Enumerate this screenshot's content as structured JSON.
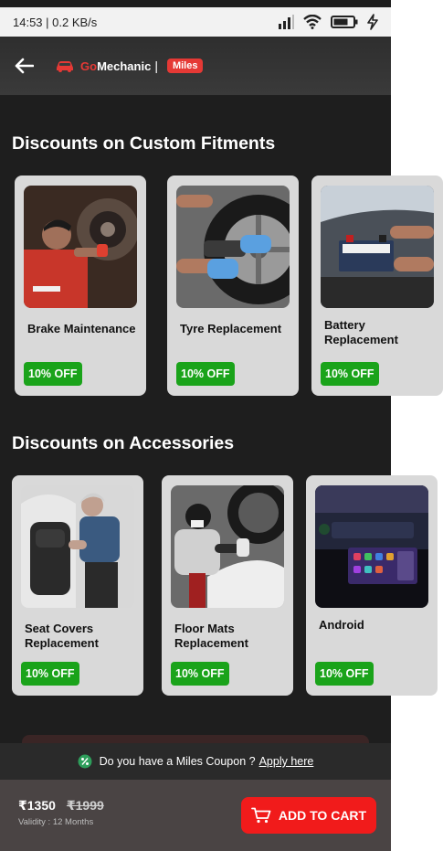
{
  "status_bar": {
    "time_speed": "14:53 | 0.2 KB/s",
    "icons": [
      "signal-icon",
      "wifi-icon",
      "battery-icon",
      "charging-icon"
    ]
  },
  "header": {
    "brand_go": "Go",
    "brand_rest": "Mechanic",
    "separator": "|",
    "badge": "Miles",
    "icons": [
      "back-arrow-icon",
      "car-logo-icon"
    ]
  },
  "sections": {
    "fitments": {
      "title": "Discounts on Custom Fitments",
      "cards": [
        {
          "label": "Brake Maintenance",
          "discount": "10% OFF"
        },
        {
          "label": "Tyre Replacement",
          "discount": "10% OFF"
        },
        {
          "label": "Battery Replacement",
          "discount": "10% OFF"
        }
      ]
    },
    "accessories": {
      "title": "Discounts on Accessories",
      "cards": [
        {
          "label": "Seat Covers Replacement",
          "discount": "10% OFF"
        },
        {
          "label": "Floor  Mats Replacement",
          "discount": "10% OFF"
        },
        {
          "label": "Android",
          "discount": "10% OFF"
        }
      ]
    }
  },
  "coupon": {
    "text": "Do you have a Miles Coupon ?",
    "link": "Apply here"
  },
  "cart": {
    "price": "₹1350",
    "old_price": "₹1999",
    "validity": "Validity : 12 Months",
    "button": "ADD TO CART"
  },
  "colors": {
    "accent_red": "#f11b1b",
    "badge_green": "#1aa31a",
    "background": "#1e1e1e",
    "card": "#d9d9d9"
  }
}
